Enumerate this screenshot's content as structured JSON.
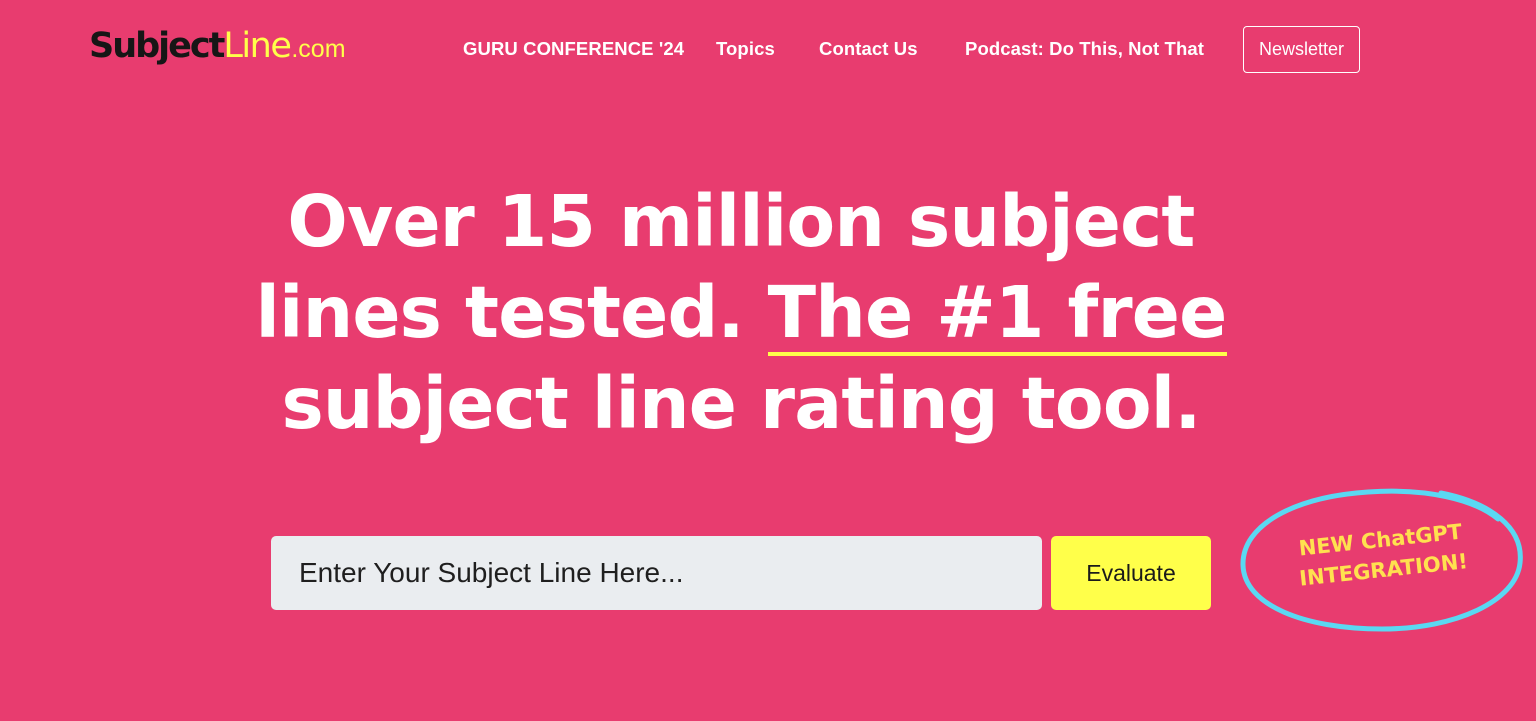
{
  "header": {
    "logo": {
      "part1": "Subject",
      "part2": "Line",
      "part3": ".com"
    },
    "nav": [
      {
        "label": "GURU CONFERENCE '24"
      },
      {
        "label": "Topics"
      },
      {
        "label": "Contact Us"
      },
      {
        "label": "Podcast: Do This, Not That"
      }
    ],
    "newsletter_label": "Newsletter"
  },
  "hero": {
    "line1": "Over 15 million subject",
    "line2_plain": "lines tested.",
    "line2_highlight": "The #1 free",
    "line3": "subject line rating tool."
  },
  "form": {
    "placeholder": "Enter Your Subject Line Here...",
    "button_label": "Evaluate"
  },
  "badge": {
    "line1": "NEW ChatGPT",
    "line2": "INTEGRATION!"
  },
  "colors": {
    "background": "#e83c6f",
    "accent_yellow": "#ffff4a",
    "badge_ring": "#5ad8f2",
    "input_bg": "#eaedf0"
  }
}
